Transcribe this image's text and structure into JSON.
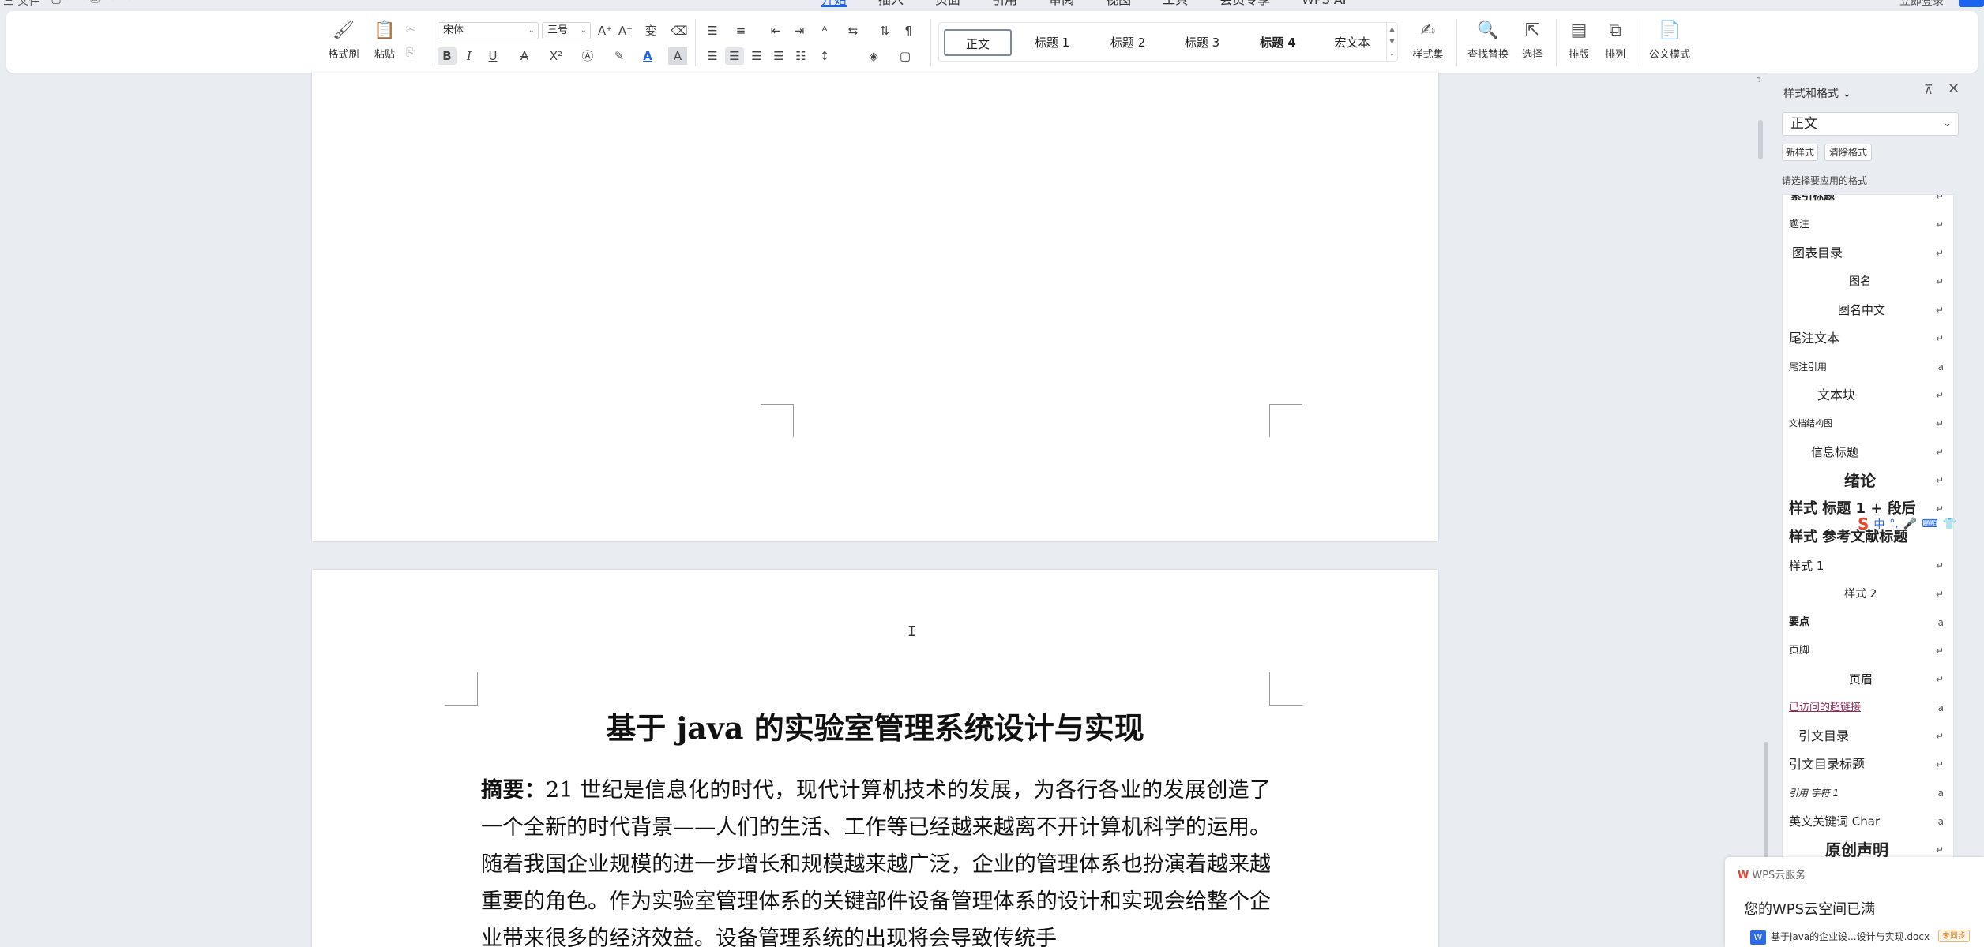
{
  "topbar": {
    "left_items": [
      "三 文件",
      "▢ ↶ ↷ ⎙",
      "↶ ↷"
    ],
    "tabs": [
      "开始",
      "插入",
      "页面",
      "引用",
      "审阅",
      "视图",
      "工具",
      "会员专享",
      "WPS AI"
    ],
    "active_tab": "开始",
    "right_text": "立即登录"
  },
  "ribbon": {
    "format_painter": "格式刷",
    "paste": "粘贴",
    "font_name": "宋体",
    "font_size": "三号",
    "styles": [
      "正文",
      "标题 1",
      "标题 2",
      "标题 3",
      "标题 4",
      "宏文本"
    ],
    "selected_style": "正文",
    "style_set": "样式集",
    "find_replace": "查找替换",
    "select": "选择",
    "layout": "排版",
    "arrange": "排列",
    "official_mode": "公文模式"
  },
  "document": {
    "title": "基于 java 的实验室管理系统设计与实现",
    "abstract_label": "摘要：",
    "abstract_text": "21 世纪是信息化的时代，现代计算机技术的发展，为各行各业的发展创造了一个全新的时代背景——人们的生活、工作等已经越来越离不开计算机科学的运用。随着我国企业规模的进一步增长和规模越来越广泛，企业的管理体系也扮演着越来越重要的角色。作为实验室管理体系的关键部件设备管理体系的设计和实现会给整个企业带来很多的经济效益。设备管理系统的出现将会导致传统手"
  },
  "styles_panel": {
    "title": "样式和格式",
    "current_style": "正文",
    "new_style": "新样式",
    "clear_format": "清除格式",
    "hint": "请选择要应用的格式",
    "items": [
      {
        "label": "索引标题",
        "indent": 10,
        "size": 14,
        "bold": true,
        "mark": "↵"
      },
      {
        "label": "题注",
        "indent": 8,
        "size": 13,
        "bold": false,
        "mark": "↵"
      },
      {
        "label": "图表目录",
        "indent": 12,
        "size": 16,
        "bold": false,
        "mark": "↵"
      },
      {
        "label": "图名",
        "indent": 84,
        "size": 14,
        "bold": false,
        "mark": "↵"
      },
      {
        "label": "图名中文",
        "indent": 70,
        "size": 15,
        "bold": false,
        "mark": "↵"
      },
      {
        "label": "尾注文本",
        "indent": 8,
        "size": 16,
        "bold": false,
        "mark": "↵"
      },
      {
        "label": "尾注引用",
        "indent": 8,
        "size": 12,
        "bold": false,
        "mark": "a"
      },
      {
        "label": "文本块",
        "indent": 44,
        "size": 16,
        "bold": false,
        "mark": "↵"
      },
      {
        "label": "文档结构图",
        "indent": 8,
        "size": 11,
        "bold": false,
        "mark": "↵"
      },
      {
        "label": "信息标题",
        "indent": 36,
        "size": 15,
        "bold": false,
        "mark": "↵"
      },
      {
        "label": "绪论",
        "indent": 78,
        "size": 20,
        "bold": true,
        "mark": "↵"
      },
      {
        "label": "样式 标题 1 + 段后",
        "indent": 8,
        "size": 18,
        "bold": true,
        "mark": "↵"
      },
      {
        "label": "样式 参考文献标题",
        "indent": 8,
        "size": 18,
        "bold": true,
        "mark": ""
      },
      {
        "label": "样式 1",
        "indent": 8,
        "size": 15,
        "bold": false,
        "mark": "↵"
      },
      {
        "label": "样式 2",
        "indent": 78,
        "size": 14,
        "bold": false,
        "mark": "↵"
      },
      {
        "label": "要点",
        "indent": 8,
        "size": 13,
        "bold": true,
        "mark": "a"
      },
      {
        "label": "页脚",
        "indent": 8,
        "size": 13,
        "bold": false,
        "mark": "↵"
      },
      {
        "label": "页眉",
        "indent": 84,
        "size": 15,
        "bold": false,
        "mark": "↵"
      },
      {
        "label": "已访问的超链接",
        "indent": 8,
        "size": 13,
        "bold": false,
        "mark": "a"
      },
      {
        "label": "引文目录",
        "indent": 20,
        "size": 16,
        "bold": false,
        "mark": "↵"
      },
      {
        "label": "引文目录标题",
        "indent": 8,
        "size": 16,
        "bold": false,
        "mark": "↵"
      },
      {
        "label": "引用 字符 1",
        "indent": 8,
        "size": 12,
        "bold": false,
        "mark": "a"
      },
      {
        "label": "英文关键词 Char",
        "indent": 8,
        "size": 15,
        "bold": false,
        "mark": "a"
      },
      {
        "label": "原创声明",
        "indent": 54,
        "size": 20,
        "bold": true,
        "mark": "↵"
      }
    ]
  },
  "ime": {
    "logo": "S",
    "items": [
      "中",
      "°,",
      "🎤",
      "⌨",
      "👕"
    ]
  },
  "notification": {
    "source": "WPS云服务",
    "title": "您的WPS云空间已满",
    "file": "基于java的企业设...设计与实现.docx",
    "badge": "未同步"
  },
  "colors": {
    "accent": "#1a64f0",
    "link_visited": "#8b2c5a",
    "background": "#e9edf2"
  }
}
